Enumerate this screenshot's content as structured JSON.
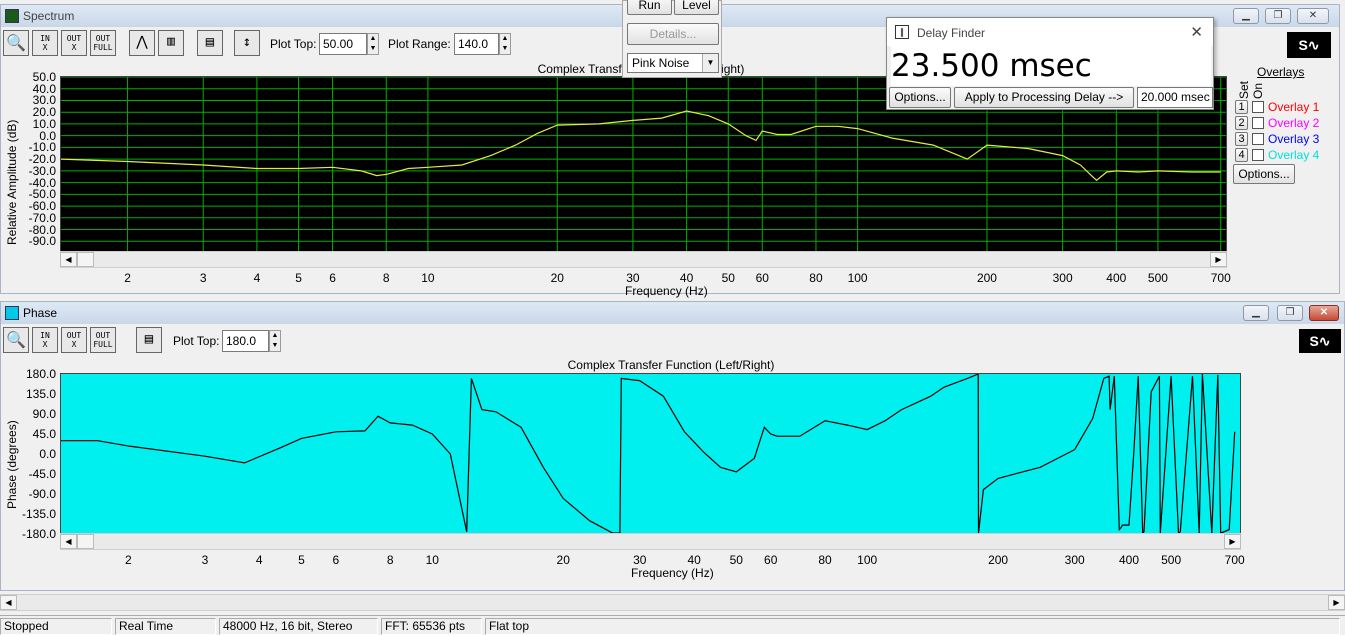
{
  "spectrum": {
    "title": "Spectrum",
    "plot_top_label": "Plot Top:",
    "plot_top_value": "50.00",
    "plot_range_label": "Plot Range:",
    "plot_range_value": "140.0",
    "chart_title": "Complex Transfer Function (Left/Right)",
    "ylabel": "Relative Amplitude (dB)",
    "xlabel": "Frequency (Hz)",
    "yticks": [
      "50.0",
      "40.0",
      "30.0",
      "20.0",
      "10.0",
      "0.0",
      "-10.0",
      "-20.0",
      "-30.0",
      "-40.0",
      "-50.0",
      "-60.0",
      "-70.0",
      "-80.0",
      "-90.0"
    ],
    "xticks": [
      "2",
      "3",
      "4",
      "5",
      "6",
      "8",
      "10",
      "20",
      "30",
      "40",
      "50",
      "60",
      "80",
      "100",
      "200",
      "300",
      "400",
      "500",
      "700"
    ],
    "bg_color": "#000000",
    "grid_color": "#00b000",
    "trace_color": "#e8e840"
  },
  "phase": {
    "title": "Phase",
    "plot_top_label": "Plot Top:",
    "plot_top_value": "180.0",
    "chart_title": "Complex Transfer Function (Left/Right)",
    "ylabel": "Phase (degrees)",
    "xlabel": "Frequency (Hz)",
    "yticks": [
      "180.0",
      "135.0",
      "90.0",
      "45.0",
      "0.0",
      "-45.0",
      "-90.0",
      "-135.0",
      "-180.0"
    ],
    "xticks": [
      "2",
      "3",
      "4",
      "5",
      "6",
      "8",
      "10",
      "20",
      "30",
      "40",
      "50",
      "60",
      "80",
      "100",
      "200",
      "300",
      "400",
      "500",
      "700"
    ],
    "bg_color": "#00f0f0",
    "trace_color": "#000000"
  },
  "generator": {
    "run_label": "Run",
    "level_label": "Level",
    "details_label": "Details...",
    "noise_value": "Pink Noise"
  },
  "delay_finder": {
    "title": "Delay Finder",
    "readout": "23.500 msec",
    "options_label": "Options...",
    "apply_label": "Apply to Processing Delay -->",
    "delay_value": "20.000 msec"
  },
  "overlays": {
    "heading": "Overlays",
    "set_label": "Set",
    "on_label": "On",
    "items": [
      {
        "num": "1",
        "label": "Overlay 1",
        "color": "#ff0000"
      },
      {
        "num": "2",
        "label": "Overlay 2",
        "color": "#ff00ff"
      },
      {
        "num": "3",
        "label": "Overlay 3",
        "color": "#0000ff"
      },
      {
        "num": "4",
        "label": "Overlay 4",
        "color": "#00e0e0"
      }
    ],
    "options_label": "Options..."
  },
  "status": {
    "state": "Stopped",
    "mode": "Real Time",
    "format": "48000 Hz, 16 bit, Stereo",
    "fft": "FFT: 65536 pts",
    "window": "Flat top"
  },
  "chart_data": [
    {
      "type": "line",
      "title": "Complex Transfer Function (Left/Right)",
      "xlabel": "Frequency (Hz)",
      "ylabel": "Relative Amplitude (dB)",
      "xscale": "log",
      "xlim": [
        1.4,
        720
      ],
      "ylim": [
        -100,
        50
      ],
      "grid": true,
      "series": [
        {
          "x": [
            1.4,
            2,
            3,
            4,
            5,
            6,
            7,
            7.6,
            8,
            9,
            10,
            12,
            14,
            16,
            18,
            20,
            25,
            30,
            35,
            40,
            45,
            50,
            55,
            58,
            60,
            65,
            70,
            80,
            90,
            100,
            120,
            150,
            180,
            200,
            250,
            300,
            330,
            350,
            360,
            380,
            400,
            450,
            500,
            600,
            700
          ],
          "values": [
            -20,
            -22,
            -25,
            -28,
            -28,
            -27,
            -30,
            -34,
            -33,
            -28,
            -27,
            -25,
            -17,
            -8,
            2,
            9,
            10,
            13,
            15,
            21,
            17,
            10,
            0,
            -4,
            4,
            1,
            1,
            8,
            8,
            6,
            -2,
            -8,
            -20,
            -8,
            -11,
            -17,
            -25,
            -34,
            -38,
            -31,
            -30,
            -31,
            -30,
            -31,
            -31
          ]
        }
      ]
    },
    {
      "type": "line",
      "title": "Complex Transfer Function (Left/Right)",
      "xlabel": "Frequency (Hz)",
      "ylabel": "Phase (degrees)",
      "xscale": "log",
      "xlim": [
        1.4,
        720
      ],
      "ylim": [
        -180,
        180
      ],
      "grid": false,
      "series": [
        {
          "x": [
            1.4,
            1.7,
            2,
            3,
            3.7,
            4.5,
            5,
            6,
            7,
            7.5,
            8,
            9,
            10,
            11,
            12,
            12.3,
            13,
            14,
            16,
            18,
            20,
            23,
            26,
            27,
            27.2,
            30,
            34,
            38,
            42,
            46,
            50,
            55,
            58,
            60,
            62,
            70,
            80,
            90,
            100,
            110,
            120,
            140,
            150,
            170,
            175,
            180,
            180.3,
            185,
            200,
            250,
            300,
            330,
            350,
            360,
            362,
            370,
            380,
            384,
            386,
            400,
            410,
            420,
            430,
            433,
            450,
            470,
            472,
            500,
            520,
            525,
            560,
            580,
            590,
            620,
            640,
            650,
            680,
            700
          ],
          "values": [
            30,
            30,
            18,
            -5,
            -20,
            15,
            35,
            50,
            52,
            85,
            70,
            65,
            45,
            0,
            -175,
            170,
            100,
            95,
            60,
            -30,
            -100,
            -150,
            -178,
            -178,
            170,
            165,
            130,
            50,
            5,
            -30,
            -40,
            -10,
            60,
            45,
            40,
            40,
            75,
            65,
            55,
            75,
            100,
            130,
            150,
            170,
            175,
            180,
            -178,
            -80,
            -55,
            -30,
            10,
            80,
            170,
            175,
            100,
            175,
            -170,
            -165,
            -160,
            -160,
            0,
            175,
            -178,
            -175,
            140,
            175,
            -178,
            175,
            -178,
            -175,
            175,
            -178,
            180,
            -178,
            178,
            -178,
            -170,
            50
          ]
        }
      ]
    }
  ]
}
